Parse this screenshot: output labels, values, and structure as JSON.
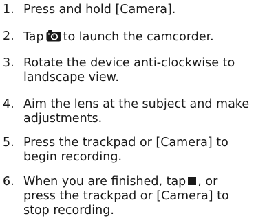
{
  "steps": [
    {
      "num": "1.",
      "text": "Press and hold [Camera]."
    },
    {
      "num": "2.",
      "text_before": "Tap",
      "icon": "camera-icon",
      "text_after": "to launch the camcorder."
    },
    {
      "num": "3.",
      "text": "Rotate the device anti-clockwise to\nlandscape view."
    },
    {
      "num": "4.",
      "text": "Aim the lens at the subject and make\nadjustments."
    },
    {
      "num": "5.",
      "text": "Press the trackpad or [Camera] to\nbegin recording."
    },
    {
      "num": "6.",
      "text_before": "When you are finished, tap",
      "icon": "stop-icon",
      "text_after": ", or\npress the trackpad or [Camera] to\nstop recording."
    }
  ]
}
